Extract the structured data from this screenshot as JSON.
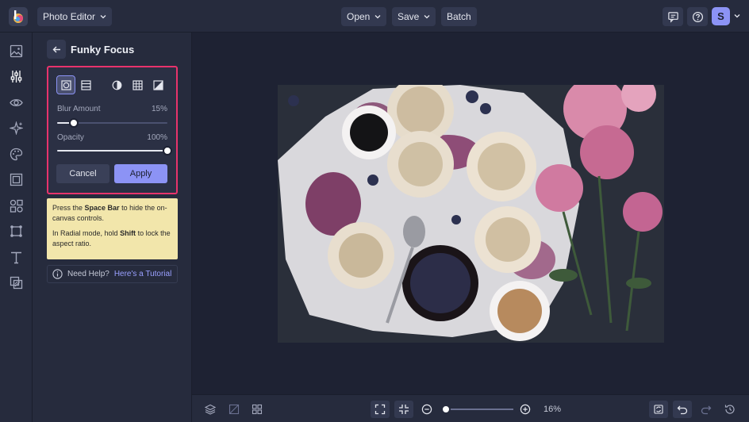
{
  "header": {
    "app_menu_label": "Photo Editor",
    "open_label": "Open",
    "save_label": "Save",
    "batch_label": "Batch",
    "avatar_initial": "S"
  },
  "rail": {
    "items": [
      "image-icon",
      "adjustments-icon",
      "eye-icon",
      "sparkle-icon",
      "palette-icon",
      "frame-icon",
      "graphics-icon",
      "texture-icon",
      "text-icon",
      "overlay-icon"
    ],
    "active_index": 1
  },
  "panel": {
    "title": "Funky Focus",
    "modes": [
      "radial-focus-icon",
      "linear-focus-icon",
      "contrast-icon",
      "grid-icon",
      "image-adjust-icon"
    ],
    "active_mode_index": 0,
    "blur_label": "Blur Amount",
    "blur_value_text": "15%",
    "blur_value": 0.15,
    "opacity_label": "Opacity",
    "opacity_value_text": "100%",
    "opacity_value": 1.0,
    "cancel_label": "Cancel",
    "apply_label": "Apply",
    "tip1_prefix": "Press the ",
    "tip1_key": "Space Bar",
    "tip1_suffix": " to hide the on-canvas controls.",
    "tip2_prefix": "In Radial mode, hold ",
    "tip2_key": "Shift",
    "tip2_suffix": " to lock the aspect ratio.",
    "help_prefix": "Need Help?",
    "help_link": "Here's a Tutorial"
  },
  "canvas": {
    "photo_alt": "Blueberry scones, coffee cups, blueberries and pink peonies on a dark table"
  },
  "footer": {
    "zoom_text": "16%",
    "zoom_value": 0.16
  },
  "colors": {
    "accent": "#8c93f5",
    "highlight": "#e8336c",
    "tip_bg": "#f2e6ab"
  }
}
